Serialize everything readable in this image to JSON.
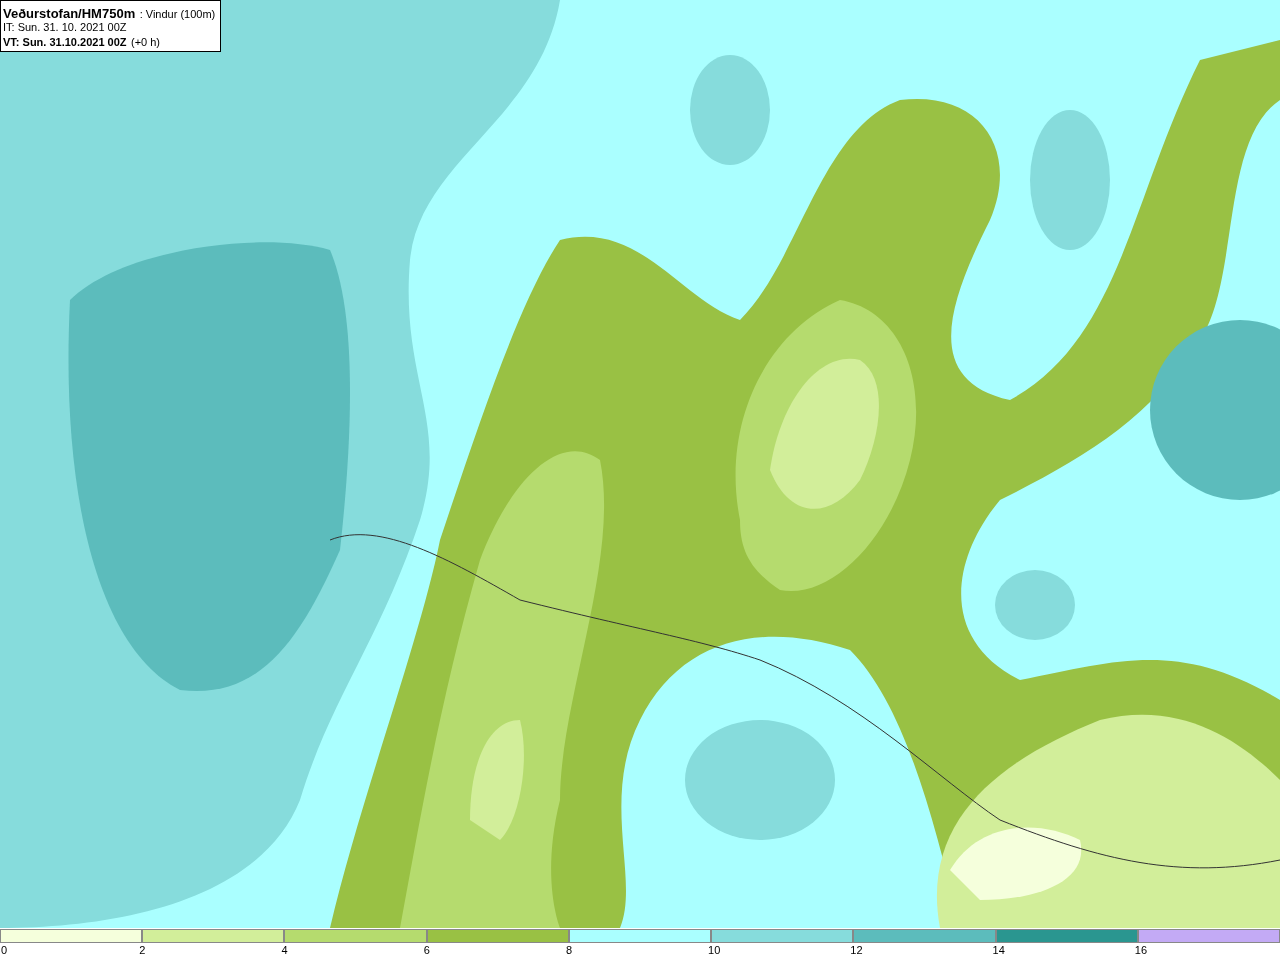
{
  "header": {
    "source": "Veðurstofan/HM750m",
    "parameter": ": Vindur (100m)",
    "issue_time": "IT: Sun. 31. 10. 2021 00Z",
    "valid_time": "VT: Sun. 31.10.2021 00Z",
    "lead": "(+0 h)"
  },
  "legend": {
    "bins": [
      {
        "color": "#f5ffdc"
      },
      {
        "color": "#d2ee9a"
      },
      {
        "color": "#b5db6e"
      },
      {
        "color": "#99c144"
      },
      {
        "color": "#aaffff"
      },
      {
        "color": "#86dcdc"
      },
      {
        "color": "#5cbcbc"
      },
      {
        "color": "#2a9690"
      },
      {
        "color": "#c3aaf5"
      }
    ],
    "ticks": [
      "0",
      "2",
      "4",
      "6",
      "8",
      "10",
      "12",
      "14",
      "16"
    ]
  }
}
